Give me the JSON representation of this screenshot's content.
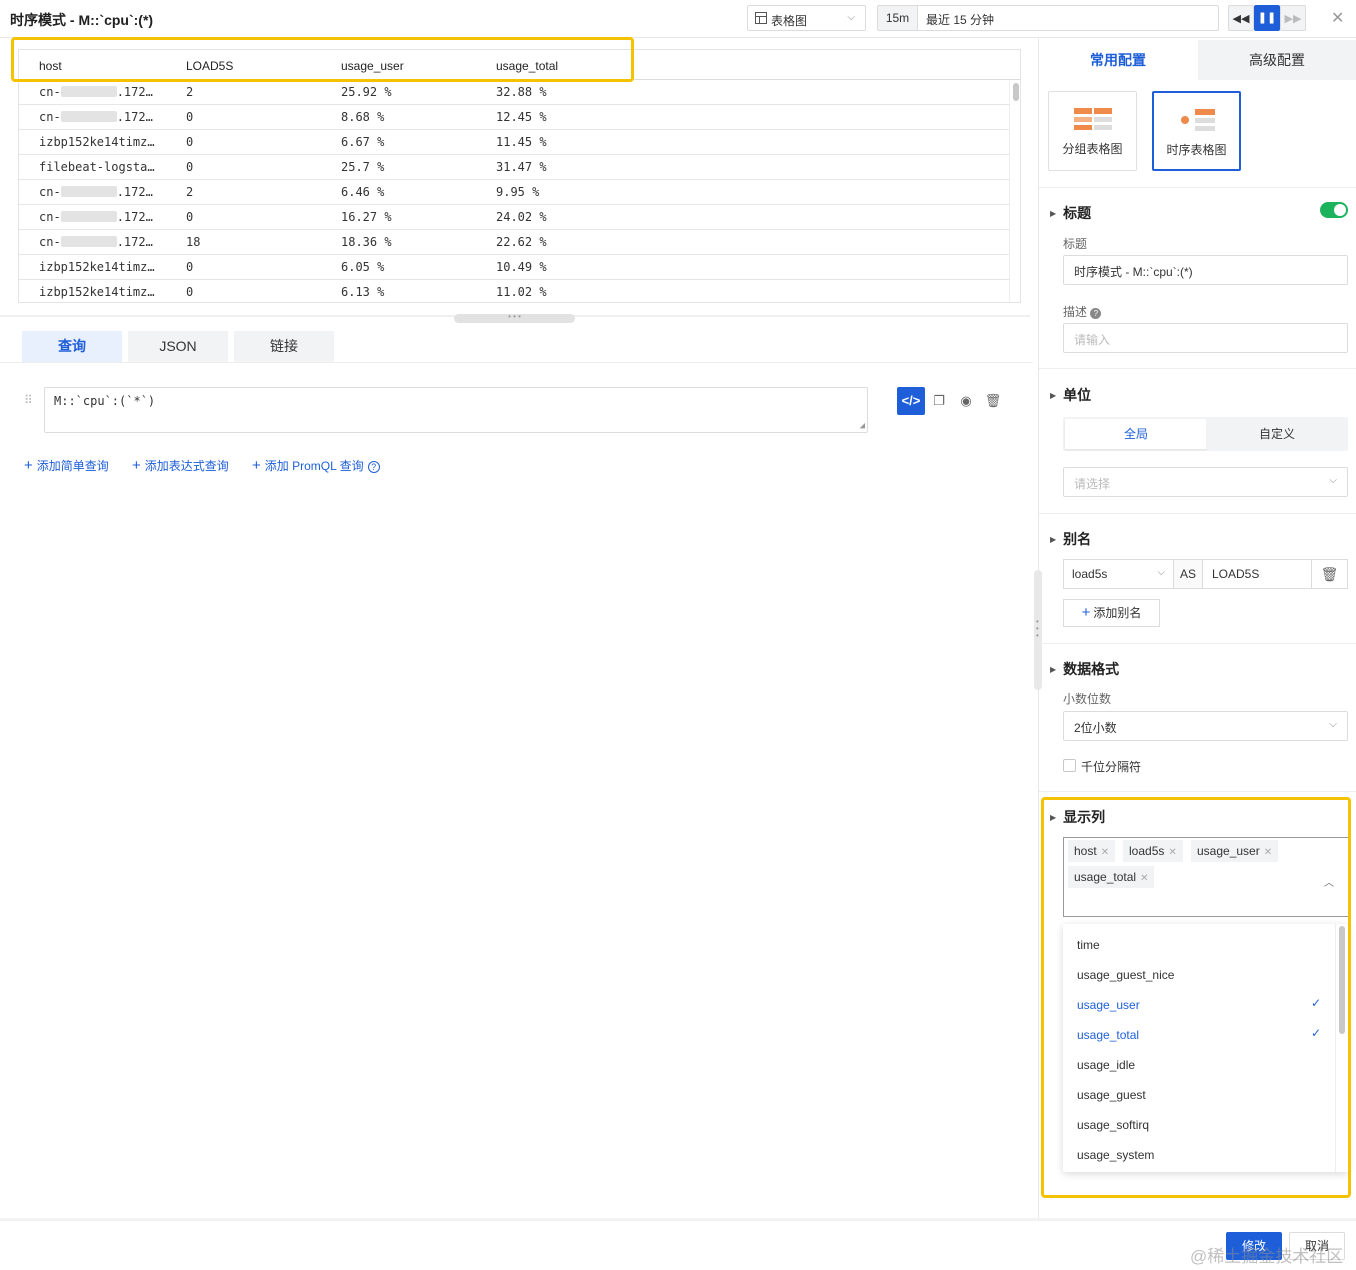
{
  "header": {
    "title": "时序模式 - M::`cpu`:(*)",
    "view_label": "表格图",
    "time_short": "15m",
    "time_long": "最近 15 分钟"
  },
  "table": {
    "columns": [
      "host",
      "LOAD5S",
      "usage_user",
      "usage_total"
    ],
    "rows": [
      {
        "host_a": "cn-",
        "host_b": ".172…",
        "load": "2",
        "user": "25.92 %",
        "total": "32.88 %"
      },
      {
        "host_a": "cn-",
        "host_b": ".172…",
        "load": "0",
        "user": "8.68 %",
        "total": "12.45 %"
      },
      {
        "host_a": "izbp152ke14timz…",
        "host_b": "",
        "load": "0",
        "user": "6.67 %",
        "total": "11.45 %"
      },
      {
        "host_a": "filebeat-logsta…",
        "host_b": "",
        "load": "0",
        "user": "25.7 %",
        "total": "31.47 %"
      },
      {
        "host_a": "cn-",
        "host_b": ".172…",
        "load": "2",
        "user": "6.46 %",
        "total": "9.95 %"
      },
      {
        "host_a": "cn-",
        "host_b": ".172…",
        "load": "0",
        "user": "16.27 %",
        "total": "24.02 %"
      },
      {
        "host_a": "cn-",
        "host_b": ".172…",
        "load": "18",
        "user": "18.36 %",
        "total": "22.62 %"
      },
      {
        "host_a": "izbp152ke14timz…",
        "host_b": "",
        "load": "0",
        "user": "6.05 %",
        "total": "10.49 %"
      },
      {
        "host_a": "izbp152ke14timz…",
        "host_b": "",
        "load": "0",
        "user": "6.13 %",
        "total": "11.02 %"
      }
    ]
  },
  "query_tabs": [
    "查询",
    "JSON",
    "链接"
  ],
  "query": {
    "text": "M::`cpu`:(`*`)",
    "add_simple": "添加简单查询",
    "add_expression": "添加表达式查询",
    "add_promql": "添加 PromQL 查询"
  },
  "panel": {
    "tab_common": "常用配置",
    "tab_advanced": "高级配置",
    "chart_types": [
      "分组表格图",
      "时序表格图"
    ],
    "title_section": "标题",
    "title_label": "标题",
    "title_value": "时序模式 - M::`cpu`:(*)",
    "desc_label": "描述",
    "desc_placeholder": "请输入",
    "unit_section": "单位",
    "unit_global": "全局",
    "unit_custom": "自定义",
    "unit_placeholder": "请选择",
    "alias_section": "别名",
    "alias_field": "load5s",
    "alias_as": "AS",
    "alias_value": "LOAD5S",
    "add_alias": "添加别名",
    "format_section": "数据格式",
    "decimal_label": "小数位数",
    "decimal_value": "2位小数",
    "thousands_label": "千位分隔符",
    "columns_section": "显示列",
    "selected_columns": [
      "host",
      "load5s",
      "usage_user",
      "usage_total"
    ],
    "options": [
      {
        "label": "time",
        "selected": false
      },
      {
        "label": "usage_guest_nice",
        "selected": false
      },
      {
        "label": "usage_user",
        "selected": true
      },
      {
        "label": "usage_total",
        "selected": true
      },
      {
        "label": "usage_idle",
        "selected": false
      },
      {
        "label": "usage_guest",
        "selected": false
      },
      {
        "label": "usage_softirq",
        "selected": false
      },
      {
        "label": "usage_system",
        "selected": false
      }
    ]
  },
  "footer": {
    "confirm": "修改",
    "cancel": "取消",
    "watermark": "@稀土掘金技术社区"
  },
  "colors": {
    "primary": "#1e5fd9",
    "highlight": "#f5c200",
    "toggle_on": "#1db35c"
  }
}
